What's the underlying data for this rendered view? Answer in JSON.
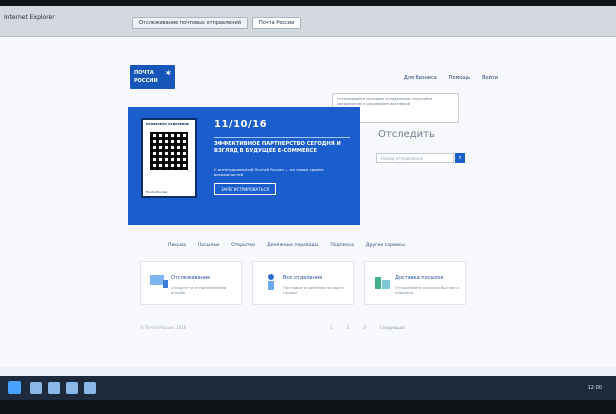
{
  "window": {
    "title": "Internet Explorer"
  },
  "tabs": [
    "Отслеживание почтовых отправлений",
    "Почта России"
  ],
  "site": {
    "logo_line1": "ПОЧТА",
    "logo_line2": "РОССИИ",
    "nav": [
      "Для бизнеса",
      "Помощь",
      "Войти"
    ],
    "tooltip": "Отслеживайте почтовые отправления, получайте уведомления и управляйте доставкой"
  },
  "banner": {
    "card_title": "ПРОВЕРЕНО ОТДЕЛЕНИЕ",
    "card_footer": "Почта России",
    "date": "11/10/16",
    "headline": "ЭФФЕКТИВНОЕ ПАРТНЕРСТВО СЕГОДНЯ И ВЗГЛЯД В БУДУЩЕЕ E-COMMERCE",
    "subtext": "С интегрированной Почтой России — на новом уровне возможностей",
    "button": "ЗАРЕГИСТРИРОВАТЬСЯ"
  },
  "tracking": {
    "title": "Отследить",
    "placeholder": "Номер отправления",
    "button_icon": "search-icon"
  },
  "menu": [
    "Письма",
    "Посылки",
    "Открытки",
    "Денежные переводы",
    "Подписка",
    "Другие сервисы"
  ],
  "cards": [
    {
      "title": "Отслеживание",
      "desc": "Следите за отправлениями онлайн",
      "icon": "screen-icon"
    },
    {
      "title": "Все отделения",
      "desc": "Почтовые отделения на карте города",
      "icon": "person-icon"
    },
    {
      "title": "Доставка посылок",
      "desc": "Отправляйте посылки быстро и надёжно",
      "icon": "box-icon"
    }
  ],
  "footer": {
    "copyright": "© Почта России, 2016",
    "pager": [
      "1",
      "2",
      "3",
      "Следующая"
    ]
  },
  "taskbar": {
    "clock": "12:00"
  },
  "colors": {
    "brand_blue": "#1a5dcc",
    "page_bg": "#f7f9fc",
    "taskbar": "#1d2a3b"
  }
}
